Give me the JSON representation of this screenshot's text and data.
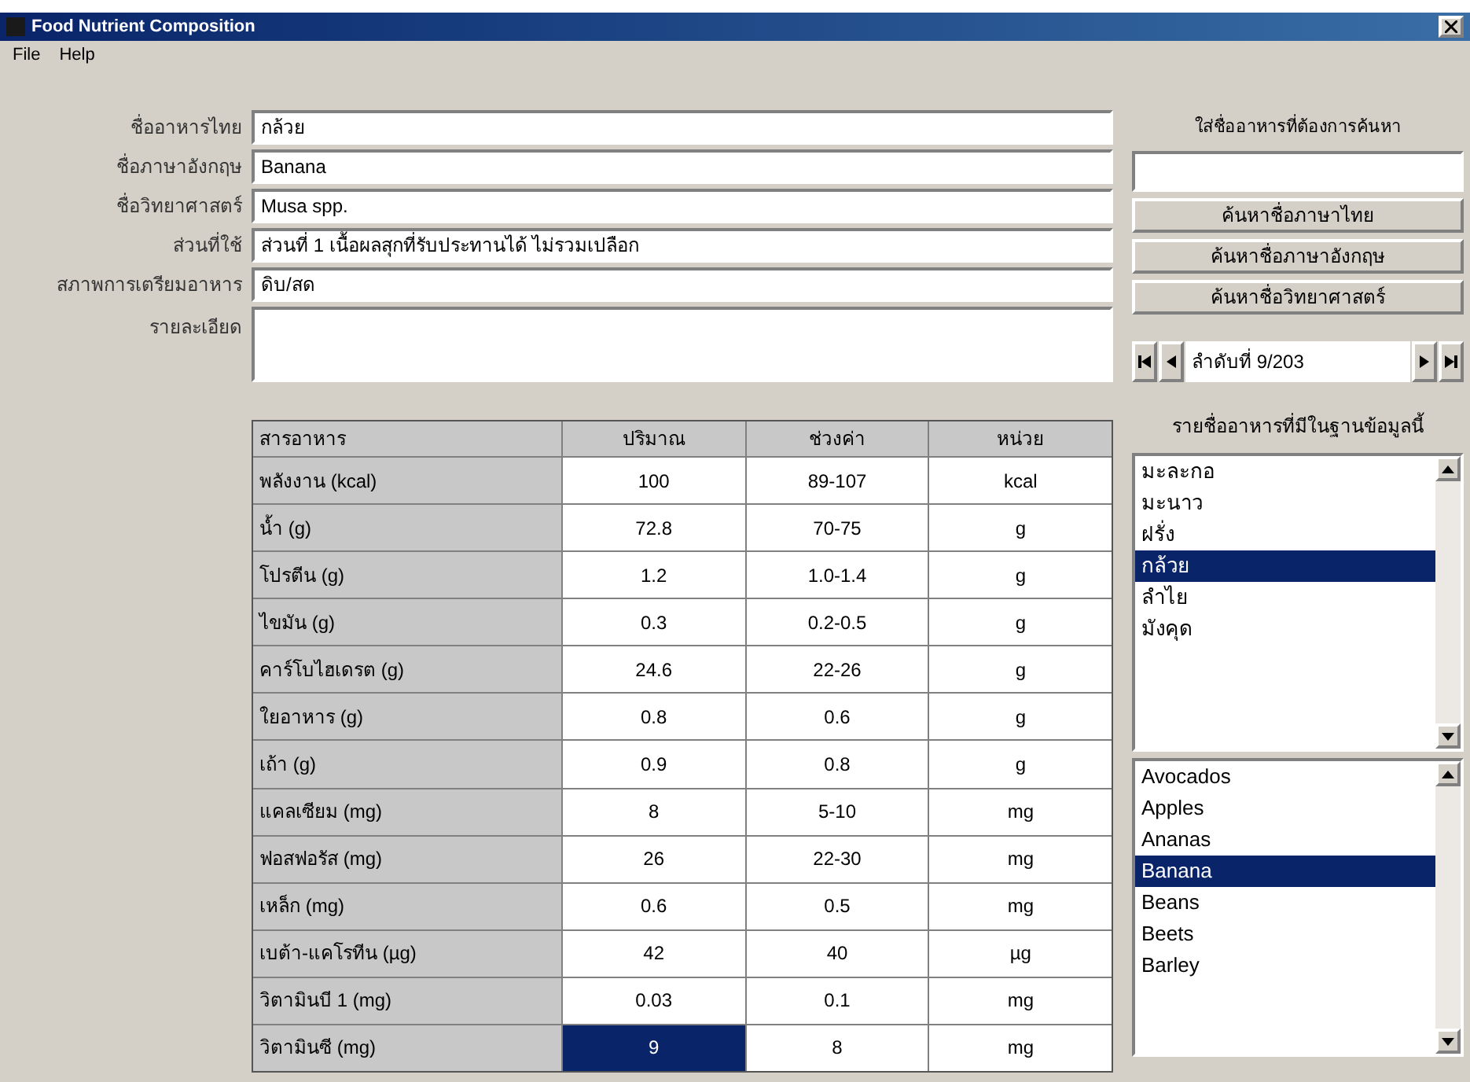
{
  "window": {
    "title": "Food Nutrient Composition"
  },
  "menu": [
    "File",
    "Help"
  ],
  "fields": [
    {
      "label": "ชื่ออาหารไทย",
      "value": "กล้วย"
    },
    {
      "label": "ชื่อภาษาอังกฤษ",
      "value": "Banana"
    },
    {
      "label": "ชื่อวิทยาศาสตร์",
      "value": "Musa spp."
    },
    {
      "label": "ส่วนที่ใช้",
      "value": "ส่วนที่ 1 เนื้อผลสุกที่รับประทานได้ ไม่รวมเปลือก"
    },
    {
      "label": "สภาพการเตรียมอาหาร",
      "value": "ดิบ/สด"
    }
  ],
  "notes": {
    "label": "รายละเอียด"
  },
  "search": {
    "label": "ใส่ชื่ออาหารที่ต้องการค้นหา",
    "buttons": [
      "ค้นหาชื่อภาษาไทย",
      "ค้นหาชื่อภาษาอังกฤษ",
      "ค้นหาชื่อวิทยาศาสตร์"
    ]
  },
  "navigator": {
    "record": "ลำดับที่ 9/203"
  },
  "list_label": "รายชื่ออาหารที่มีในฐานข้อมูลนี้",
  "thai_list": [
    {
      "label": "มะละกอ",
      "selected": false
    },
    {
      "label": "มะนาว",
      "selected": false
    },
    {
      "label": "ฝรั่ง",
      "selected": false
    },
    {
      "label": "กล้วย",
      "selected": true
    },
    {
      "label": "ลำไย",
      "selected": false
    },
    {
      "label": "มังคุด",
      "selected": false
    }
  ],
  "english_list": [
    {
      "label": "Avocados",
      "selected": false
    },
    {
      "label": "Apples",
      "selected": false
    },
    {
      "label": "Ananas",
      "selected": false
    },
    {
      "label": "Banana",
      "selected": true
    },
    {
      "label": "Beans",
      "selected": false
    },
    {
      "label": "Beets",
      "selected": false
    },
    {
      "label": "Barley",
      "selected": false
    }
  ],
  "table": {
    "columns": [
      "สารอาหาร",
      "ปริมาณ",
      "ช่วงค่า",
      "หน่วย"
    ],
    "rows": [
      {
        "cells": [
          {
            "text": "พลังงาน (kcal)",
            "selected": false
          },
          {
            "text": "100",
            "selected": false
          },
          {
            "text": "89-107",
            "selected": false
          },
          {
            "text": "kcal",
            "selected": false
          }
        ]
      },
      {
        "cells": [
          {
            "text": "น้ำ (g)",
            "selected": false
          },
          {
            "text": "72.8",
            "selected": false
          },
          {
            "text": "70-75",
            "selected": false
          },
          {
            "text": "g",
            "selected": false
          }
        ]
      },
      {
        "cells": [
          {
            "text": "โปรตีน (g)",
            "selected": false
          },
          {
            "text": "1.2",
            "selected": false
          },
          {
            "text": "1.0-1.4",
            "selected": false
          },
          {
            "text": "g",
            "selected": false
          }
        ]
      },
      {
        "cells": [
          {
            "text": "ไขมัน (g)",
            "selected": false
          },
          {
            "text": "0.3",
            "selected": false
          },
          {
            "text": "0.2-0.5",
            "selected": false
          },
          {
            "text": "g",
            "selected": false
          }
        ]
      },
      {
        "cells": [
          {
            "text": "คาร์โบไฮเดรต (g)",
            "selected": false
          },
          {
            "text": "24.6",
            "selected": false
          },
          {
            "text": "22-26",
            "selected": false
          },
          {
            "text": "g",
            "selected": false
          }
        ]
      },
      {
        "cells": [
          {
            "text": "ใยอาหาร (g)",
            "selected": false
          },
          {
            "text": "0.8",
            "selected": false
          },
          {
            "text": "0.6",
            "selected": false
          },
          {
            "text": "g",
            "selected": false
          }
        ]
      },
      {
        "cells": [
          {
            "text": "เถ้า (g)",
            "selected": false
          },
          {
            "text": "0.9",
            "selected": false
          },
          {
            "text": "0.8",
            "selected": false
          },
          {
            "text": "g",
            "selected": false
          }
        ]
      },
      {
        "cells": [
          {
            "text": "แคลเซียม (mg)",
            "selected": false
          },
          {
            "text": "8",
            "selected": false
          },
          {
            "text": "5-10",
            "selected": false
          },
          {
            "text": "mg",
            "selected": false
          }
        ]
      },
      {
        "cells": [
          {
            "text": "ฟอสฟอรัส (mg)",
            "selected": false
          },
          {
            "text": "26",
            "selected": false
          },
          {
            "text": "22-30",
            "selected": false
          },
          {
            "text": "mg",
            "selected": false
          }
        ]
      },
      {
        "cells": [
          {
            "text": "เหล็ก (mg)",
            "selected": false
          },
          {
            "text": "0.6",
            "selected": false
          },
          {
            "text": "0.5",
            "selected": false
          },
          {
            "text": "mg",
            "selected": false
          }
        ]
      },
      {
        "cells": [
          {
            "text": "เบต้า-แคโรทีน (µg)",
            "selected": false
          },
          {
            "text": "42",
            "selected": false
          },
          {
            "text": "40",
            "selected": false
          },
          {
            "text": "µg",
            "selected": false
          }
        ]
      },
      {
        "cells": [
          {
            "text": "วิตามินบี 1 (mg)",
            "selected": false
          },
          {
            "text": "0.03",
            "selected": false
          },
          {
            "text": "0.1",
            "selected": false
          },
          {
            "text": "mg",
            "selected": false
          }
        ]
      },
      {
        "cells": [
          {
            "text": "วิตามินซี (mg)",
            "selected": false
          },
          {
            "text": "9",
            "selected": true
          },
          {
            "text": "8",
            "selected": false
          },
          {
            "text": "mg",
            "selected": false
          }
        ]
      }
    ]
  }
}
